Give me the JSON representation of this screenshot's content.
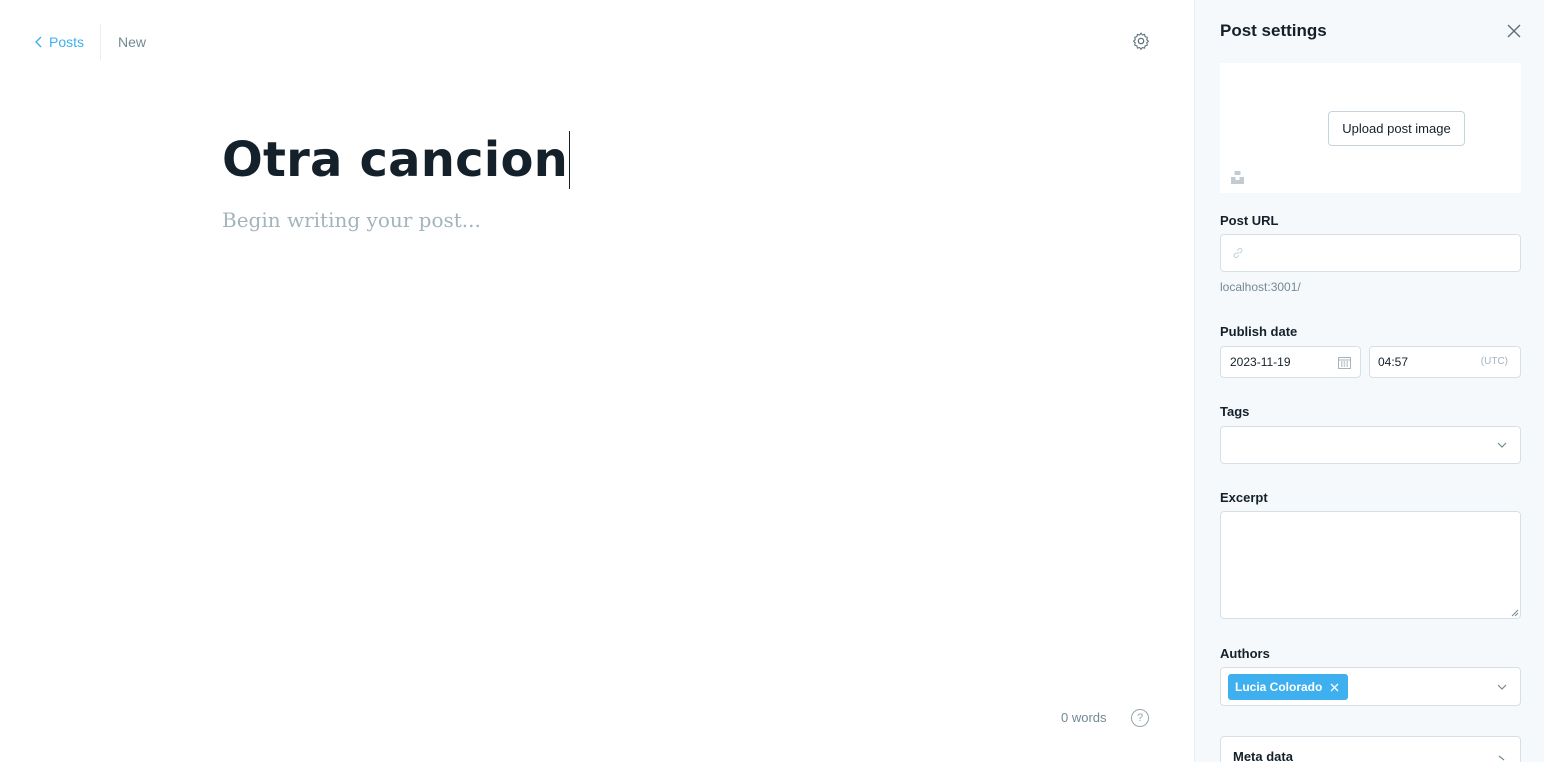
{
  "breadcrumb": {
    "back_label": "Posts",
    "status": "New"
  },
  "editor": {
    "title": "Otra cancion",
    "body_placeholder": "Begin writing your post...",
    "word_count": "0 words",
    "help_glyph": "?"
  },
  "settings": {
    "title": "Post settings",
    "upload_image_label": "Upload post image",
    "post_url": {
      "label": "Post URL",
      "value": "",
      "help": "localhost:3001/"
    },
    "publish_date": {
      "label": "Publish date",
      "date": "2023-11-19",
      "time": "04:57",
      "timezone": "(UTC)"
    },
    "tags": {
      "label": "Tags",
      "value": ""
    },
    "excerpt": {
      "label": "Excerpt",
      "value": ""
    },
    "authors": {
      "label": "Authors",
      "items": [
        "Lucia Colorado"
      ]
    },
    "meta_data": {
      "label": "Meta data"
    }
  },
  "colors": {
    "accent": "#3eb0ef",
    "muted": "#738a94",
    "border": "#d5e0e6",
    "panel_bg": "#f6f9fb"
  },
  "icons": {
    "back": "chevron-left-icon",
    "settings": "gear-icon",
    "close": "close-icon",
    "unsplash": "unsplash-icon",
    "link": "link-icon",
    "calendar": "calendar-icon",
    "dropdown": "chevron-down-icon",
    "remove": "close-icon",
    "help": "question-icon"
  }
}
